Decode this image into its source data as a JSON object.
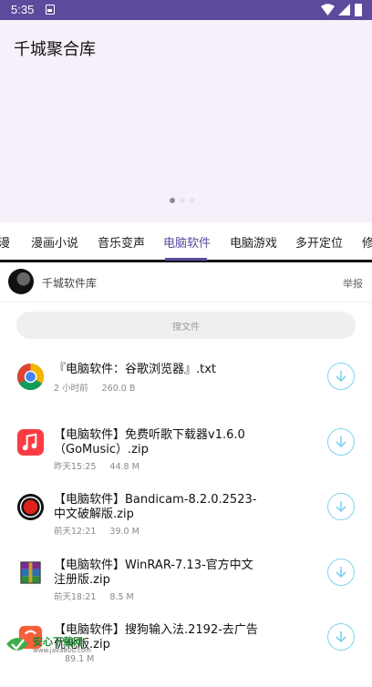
{
  "status_bar": {
    "time": "5:35"
  },
  "hero": {
    "title": "千城聚合库"
  },
  "tabs": [
    "漫",
    "漫画小说",
    "音乐变声",
    "电脑软件",
    "电脑游戏",
    "多开定位",
    "修"
  ],
  "active_tab": "电脑软件",
  "channel": {
    "name": "千城软件库",
    "report": "举报"
  },
  "search": {
    "placeholder": "搜文件"
  },
  "files": [
    {
      "name": "『电脑软件：谷歌浏览器』.txt",
      "time": "2 小时前",
      "size": "260.0 B",
      "icon": "chrome-icon"
    },
    {
      "name": "【电脑软件】免费听歌下载器v1.6.0（GoMusic）.zip",
      "time": "昨天15:25",
      "size": "44.8 M",
      "icon": "music-app-icon"
    },
    {
      "name": "【电脑软件】Bandicam-8.2.0.2523-中文破解版.zip",
      "time": "前天12:21",
      "size": "39.0 M",
      "icon": "record-icon"
    },
    {
      "name": "【电脑软件】WinRAR-7.13-官方中文注册版.zip",
      "time": "前天18:21",
      "size": "8.5 M",
      "icon": "winrar-icon"
    },
    {
      "name": "【电脑软件】搜狗输入法.2192-去广告优化版.zip",
      "time": "",
      "size": "89.1 M",
      "icon": "sogou-icon"
    }
  ],
  "watermark": {
    "text": "安心下载网",
    "url": "www.java800.com"
  }
}
